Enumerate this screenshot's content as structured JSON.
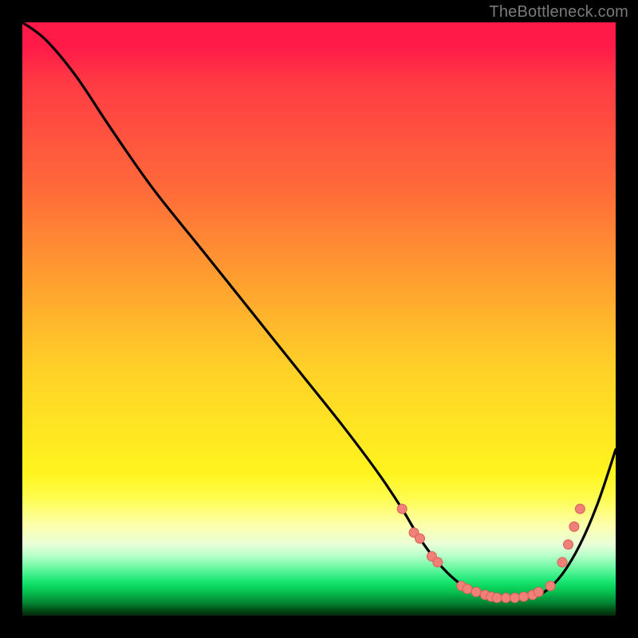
{
  "watermark": "TheBottleneck.com",
  "colors": {
    "background": "#000000",
    "curve_stroke": "#000000",
    "marker_fill": "#f08078",
    "marker_stroke": "#d86058",
    "gradient_top": "#ff1a48",
    "gradient_bottom": "#002808"
  },
  "chart_data": {
    "type": "line",
    "title": "",
    "xlabel": "",
    "ylabel": "",
    "xlim": [
      0,
      100
    ],
    "ylim": [
      0,
      100
    ],
    "grid": false,
    "legend": false,
    "curve": {
      "x": [
        0,
        4,
        9,
        15,
        22,
        30,
        38,
        46,
        54,
        60,
        64,
        67,
        70,
        73,
        76,
        79,
        82,
        85,
        88,
        91,
        94,
        97,
        100
      ],
      "y": [
        100,
        97,
        91,
        82,
        72,
        62,
        52,
        42,
        32,
        24,
        18,
        13,
        9,
        6,
        4,
        3,
        3,
        3,
        4,
        7,
        12,
        19,
        28
      ]
    },
    "markers": [
      {
        "x": 64,
        "y": 18
      },
      {
        "x": 66,
        "y": 14
      },
      {
        "x": 67,
        "y": 13
      },
      {
        "x": 69,
        "y": 10
      },
      {
        "x": 70,
        "y": 9
      },
      {
        "x": 74,
        "y": 5
      },
      {
        "x": 75,
        "y": 4.5
      },
      {
        "x": 76.5,
        "y": 4
      },
      {
        "x": 78,
        "y": 3.5
      },
      {
        "x": 79,
        "y": 3.2
      },
      {
        "x": 80,
        "y": 3
      },
      {
        "x": 81.5,
        "y": 3
      },
      {
        "x": 83,
        "y": 3
      },
      {
        "x": 84.5,
        "y": 3.2
      },
      {
        "x": 86,
        "y": 3.5
      },
      {
        "x": 87,
        "y": 4
      },
      {
        "x": 89,
        "y": 5
      },
      {
        "x": 91,
        "y": 9
      },
      {
        "x": 92,
        "y": 12
      },
      {
        "x": 93,
        "y": 15
      },
      {
        "x": 94,
        "y": 18
      }
    ]
  }
}
